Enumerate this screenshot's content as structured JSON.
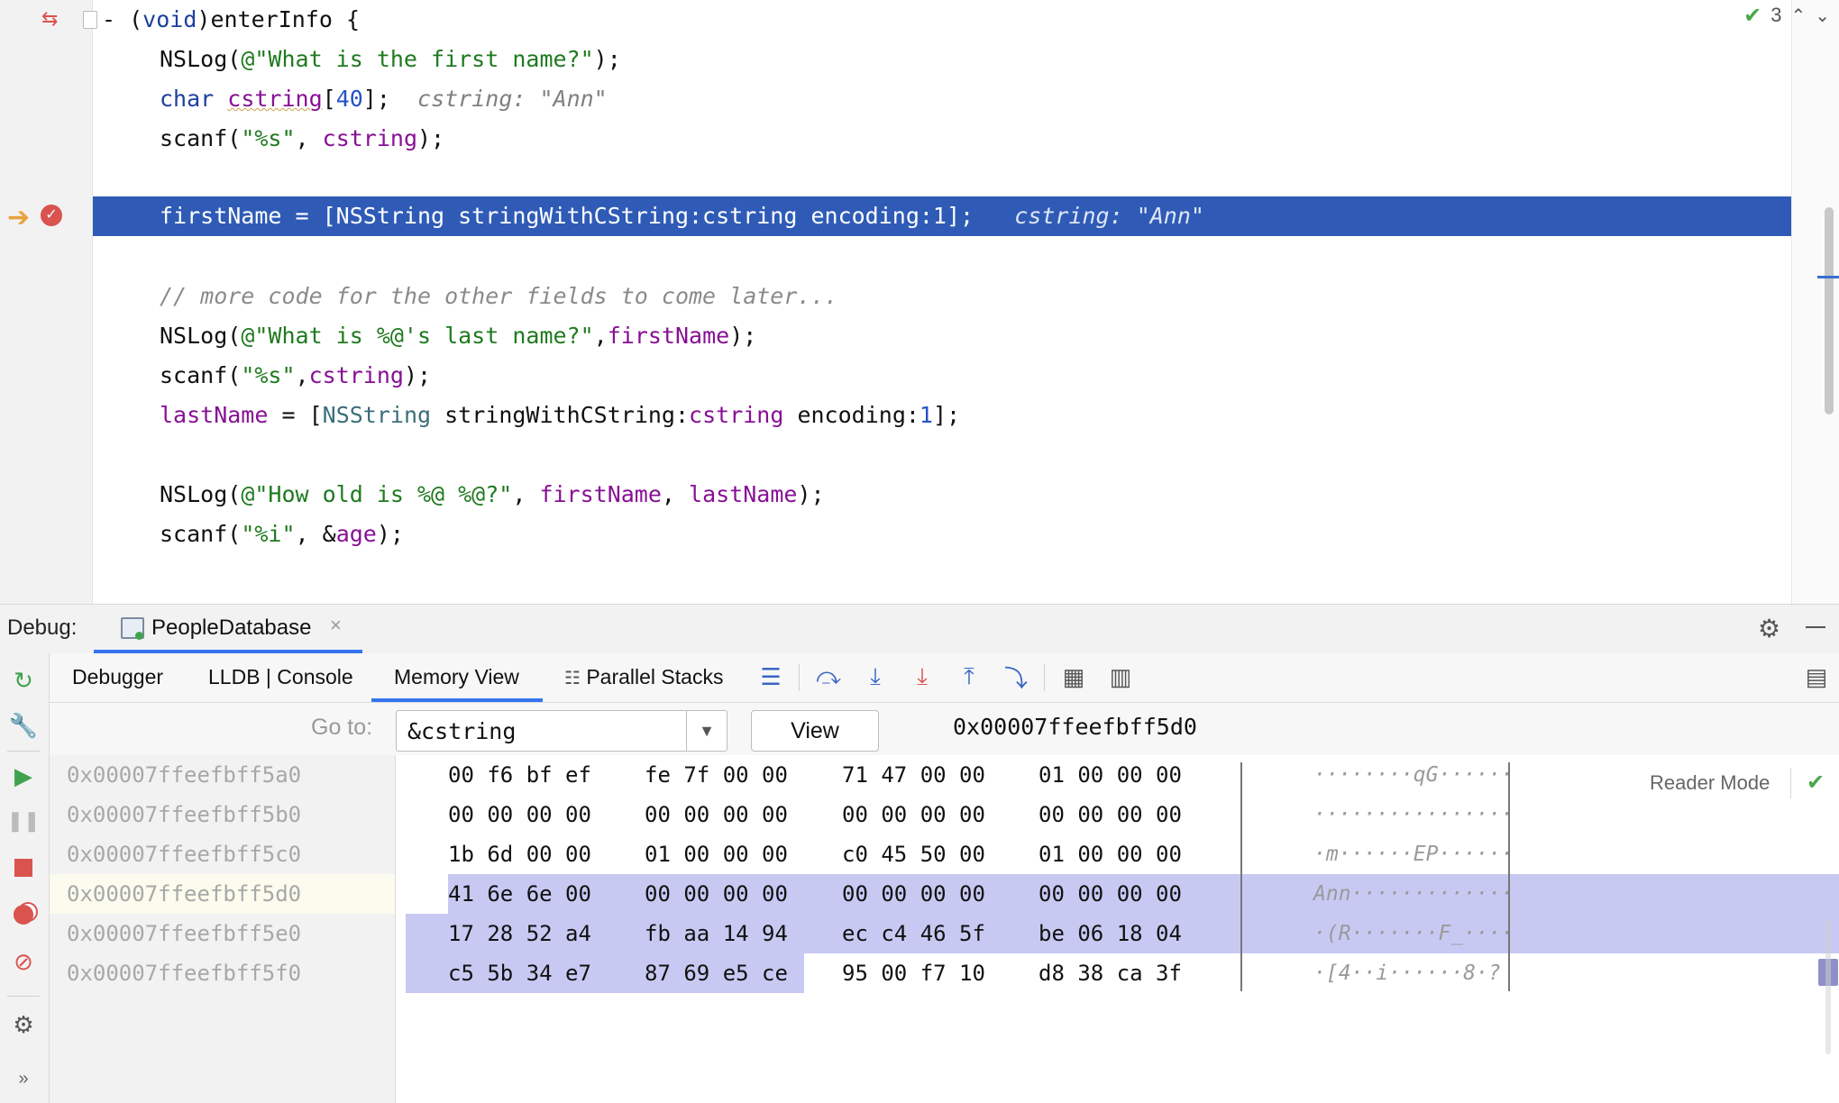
{
  "editor": {
    "signature": [
      "- ",
      "(",
      "void",
      ")enterInfo {"
    ],
    "lines": {
      "l1": [
        "NSLog(",
        "@\"What is the first name?\"",
        ");"
      ],
      "l2": [
        "char ",
        "cstring",
        "[",
        "40",
        "];",
        "cstring: \"Ann\""
      ],
      "l3": [
        "scanf(",
        "\"%s\"",
        ", ",
        "cstring",
        ");"
      ],
      "l4": [
        "firstName = [NSString stringWithCString:cstring encoding:1];",
        "cstring: \"Ann\""
      ],
      "l5": [
        "// more code for the other fields to come later..."
      ],
      "l6": [
        "NSLog(",
        "@\"What is %@'s last name?\"",
        ",",
        "firstName",
        ");"
      ],
      "l7": [
        "scanf(",
        "\"%s\"",
        ",",
        "cstring",
        ");"
      ],
      "l8": [
        "lastName",
        " = [",
        "NSString",
        " stringWithCString:",
        "cstring",
        " encoding:",
        "1",
        "];"
      ],
      "l9": [
        "NSLog(",
        "@\"How old is %@ %@?\"",
        ", ",
        "firstName",
        ", ",
        "lastName",
        ");"
      ],
      "l10": [
        "scanf(",
        "\"%i\"",
        ", &",
        "age",
        ");"
      ]
    },
    "status": {
      "count": "3"
    }
  },
  "debug": {
    "label": "Debug:",
    "session_tab": "PeopleDatabase",
    "tabs": [
      "Debugger",
      "LLDB | Console",
      "Memory View",
      "Parallel Stacks"
    ],
    "active_tab": "Memory View"
  },
  "memory": {
    "goto_label": "Go to:",
    "goto_value": "&cstring",
    "view_button": "View",
    "current_address": "0x00007ffeefbff5d0",
    "reader_mode": "Reader Mode",
    "rows": [
      {
        "addr": "0x00007ffeefbff5a0",
        "g1": "00 f6 bf ef",
        "g2": "fe 7f 00 00",
        "g3": "71 47 00 00",
        "g4": "01 00 00 00",
        "ascii": "········qG······"
      },
      {
        "addr": "0x00007ffeefbff5b0",
        "g1": "00 00 00 00",
        "g2": "00 00 00 00",
        "g3": "00 00 00 00",
        "g4": "00 00 00 00",
        "ascii": "················"
      },
      {
        "addr": "0x00007ffeefbff5c0",
        "g1": "1b 6d 00 00",
        "g2": "01 00 00 00",
        "g3": "c0 45 50 00",
        "g4": "01 00 00 00",
        "ascii": "·m······EP······"
      },
      {
        "addr": "0x00007ffeefbff5d0",
        "g1": "41 6e 6e 00",
        "g2": "00 00 00 00",
        "g3": "00 00 00 00",
        "g4": "00 00 00 00",
        "ascii": "Ann·············"
      },
      {
        "addr": "0x00007ffeefbff5e0",
        "g1": "17 28 52 a4",
        "g2": "fb aa 14 94",
        "g3": "ec c4 46 5f",
        "g4": "be 06 18 04",
        "ascii": "·(R·······F_····"
      },
      {
        "addr": "0x00007ffeefbff5f0",
        "g1": "c5 5b 34 e7",
        "g2": "87 69 e5 ce",
        "g3": "95 00 f7 10",
        "g4": "d8 38 ca 3f",
        "ascii": "·[4··i······8·?"
      }
    ]
  },
  "colors": {
    "accent": "#3574f0",
    "current_line": "#2f5bb7",
    "selection": "#c8c9f3"
  }
}
